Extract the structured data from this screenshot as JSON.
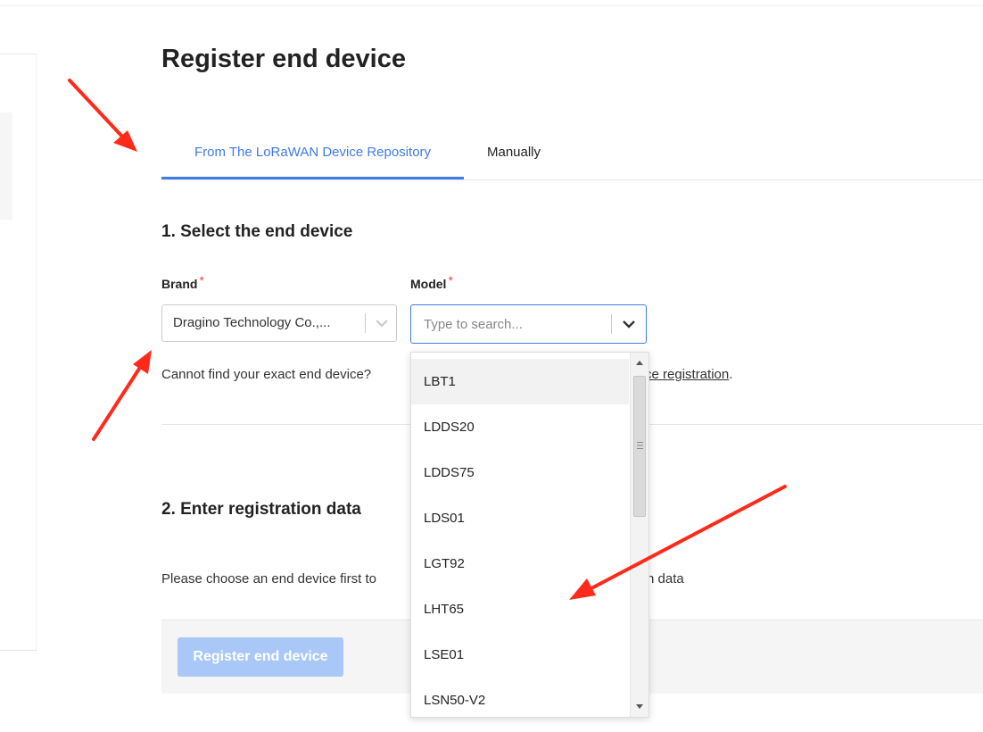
{
  "page": {
    "title": "Register end device"
  },
  "tabs": [
    {
      "label": "From The LoRaWAN Device Repository",
      "active": true
    },
    {
      "label": "Manually",
      "active": false
    }
  ],
  "section1": {
    "title": "1. Select the end device",
    "brand": {
      "label": "Brand",
      "required_mark": "*",
      "value": "Dragino Technology Co.,..."
    },
    "model": {
      "label": "Model",
      "required_mark": "*",
      "value": "",
      "placeholder": "Type to search..."
    },
    "hint_text": "Cannot find your exact end device?",
    "hint_link": "ce registration",
    "hint_end": "."
  },
  "dropdown": {
    "options": [
      "LBT1",
      "LDDS20",
      "LDDS75",
      "LDS01",
      "LGT92",
      "LHT65",
      "LSE01",
      "LSN50-V2"
    ],
    "highlighted_option": "LBT1"
  },
  "section2": {
    "title": "2. Enter registration data",
    "hint_text": "Please choose an end device first to",
    "hint_tail": "n data"
  },
  "actions": {
    "register_label": "Register end device",
    "register_disabled": true
  },
  "annotations": {
    "arrow_color": "#ff2a1a",
    "arrow_count": 3
  },
  "colors": {
    "accent": "#3f7be8",
    "required": "#e5483f",
    "disabled_button": "#a9c7f7"
  }
}
